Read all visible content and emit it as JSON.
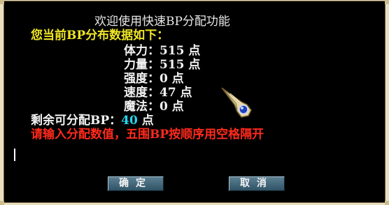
{
  "dialog": {
    "title": "欢迎使用快速BP分配功能",
    "intro": "您当前BP分布数据如下：",
    "stats": [
      {
        "label": "体力：",
        "value": "515",
        "unit": "点"
      },
      {
        "label": "力量：",
        "value": "515",
        "unit": "点"
      },
      {
        "label": "强度：",
        "value": "0",
        "unit": "点"
      },
      {
        "label": "速度：",
        "value": "47",
        "unit": "点"
      },
      {
        "label": "魔法：",
        "value": "0",
        "unit": "点"
      }
    ],
    "remaining_label": "剩余可分配BP：",
    "remaining_value": "40",
    "remaining_unit": "点",
    "instruction": "请输入分配数值，五围BP按顺序用空格隔开",
    "input_value": ""
  },
  "buttons": {
    "ok_label": "确定",
    "cancel_label": "取消"
  },
  "icons": {
    "cursor": "gauntlet-pointer-icon"
  }
}
